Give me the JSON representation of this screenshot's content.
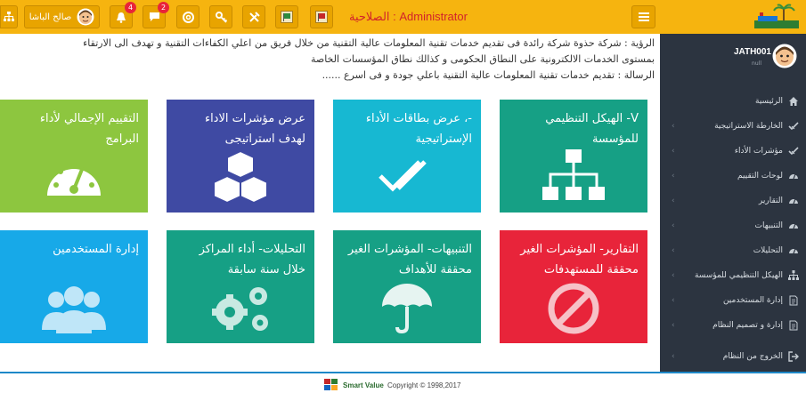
{
  "header": {
    "user_name": "صالح الباشا",
    "notifications_count": "4",
    "messages_count": "2",
    "permission_label": "الصلاحية : Administrator"
  },
  "sidebar": {
    "profile_name": "JATH001",
    "profile_status": "null",
    "items": [
      {
        "label": "الرئيسية",
        "icon": "home-icon"
      },
      {
        "label": "الخارطة الاستراتيجية",
        "icon": "check-icon"
      },
      {
        "label": "مؤشرات الأداء",
        "icon": "check-icon"
      },
      {
        "label": "لوحات التقييم",
        "icon": "dashboard-icon"
      },
      {
        "label": "التقارير",
        "icon": "dashboard-icon"
      },
      {
        "label": "التنبيهات",
        "icon": "dashboard-icon"
      },
      {
        "label": "التحليلات",
        "icon": "dashboard-icon"
      },
      {
        "label": "الهيكل التنظيمي للمؤسسة",
        "icon": "sitemap-icon"
      },
      {
        "label": "إدارة المستخدمين",
        "icon": "file-icon"
      },
      {
        "label": "إدارة و تصميم النظام",
        "icon": "file-icon"
      },
      {
        "label": "الخروج من النظام",
        "icon": "logout-icon"
      }
    ]
  },
  "vision": {
    "line1": "الرؤية : شركة حذوة شركة رائدة فى تقديم خدمات تقنية المعلومات عالية التقنية من خلال فريق من اعلي الكفاءات التقنية و تهدف الى الارتقاء",
    "line2": "بمستوى الخدمات الالكترونية على النطاق الحكومى و كذالك نطاق المؤسسات الخاصة",
    "line3": "الرسالة : تقديم خدمات تقنية المعلومات عالية التقنية باعلي جودة و فى اسرع ......"
  },
  "tiles": [
    {
      "label": "V- الهيكل التنظيمي للمؤسسة",
      "color": "#16a085",
      "icon": "sitemap-icon"
    },
    {
      "label": "-، عرض بطاقات الأداء الإستراتيجية",
      "color": "#17b8d2",
      "icon": "double-check-icon"
    },
    {
      "label": "عرض مؤشرات الاداء لهدف استراتيجى",
      "color": "#3f4aa3",
      "icon": "cubes-icon"
    },
    {
      "label": "التقييم الإجمالي لأداء البرامج",
      "color": "#8dc63f",
      "icon": "gauge-icon"
    },
    {
      "label": "التقارير- المؤشرات الغير محققة للمستهدفات",
      "color": "#e8243a",
      "icon": "ban-icon"
    },
    {
      "label": "التنبيهات- المؤشرات الغير محققة للأهداف",
      "color": "#16a085",
      "icon": "umbrella-icon"
    },
    {
      "label": "التحليلات- أداء المراكز خلال سنة سابقة",
      "color": "#16a085",
      "icon": "gears-icon"
    },
    {
      "label": "إدارة المستخدمين",
      "color": "#17a9e8",
      "icon": "users-icon"
    }
  ],
  "footer": {
    "brand": "Smart Value",
    "copyright": "Copyright © 1998,2017"
  }
}
